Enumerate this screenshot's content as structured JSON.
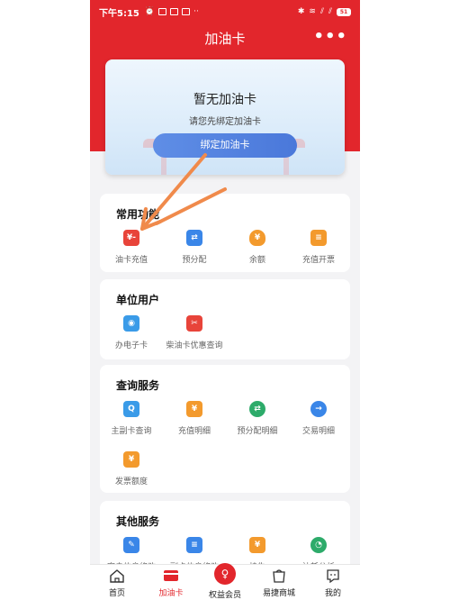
{
  "status_bar": {
    "time": "下午5:15",
    "battery": "51",
    "notification_icons": [
      "alarm-icon",
      "app-icon",
      "app-icon",
      "message-icon",
      "dots-icon"
    ],
    "system_icons": [
      "bluetooth-icon",
      "wifi-signal-icon",
      "signal-icon",
      "signal-icon",
      "battery-icon"
    ]
  },
  "header": {
    "title": "加油卡",
    "more_label": "•••"
  },
  "card": {
    "title": "暂无加油卡",
    "subtitle": "请您先绑定加油卡",
    "bind_button": "绑定加油卡"
  },
  "sections": [
    {
      "title": "常用功能",
      "items": [
        {
          "label": "油卡充值",
          "icon": "yuan-card-icon",
          "glyph": "¥-",
          "color": "#e8443a"
        },
        {
          "label": "预分配",
          "icon": "allocate-icon",
          "glyph": "⇄",
          "color": "#3a86e8"
        },
        {
          "label": "余额",
          "icon": "money-bag-icon",
          "glyph": "¥",
          "color": "#f39a2d"
        },
        {
          "label": "充值开票",
          "icon": "invoice-icon",
          "glyph": "≡",
          "color": "#f39a2d"
        }
      ]
    },
    {
      "title": "单位用户",
      "items": [
        {
          "label": "办电子卡",
          "icon": "nfc-card-icon",
          "glyph": "◉",
          "color": "#3a9be8"
        },
        {
          "label": "柴油卡优惠查询",
          "icon": "ticket-icon",
          "glyph": "✂",
          "color": "#e8443a"
        }
      ]
    },
    {
      "title": "查询服务",
      "items": [
        {
          "label": "主副卡查询",
          "icon": "search-card-icon",
          "glyph": "Q",
          "color": "#3a9be8"
        },
        {
          "label": "充值明细",
          "icon": "clipboard-icon",
          "glyph": "¥",
          "color": "#f39a2d"
        },
        {
          "label": "预分配明细",
          "icon": "transfer-detail-icon",
          "glyph": "⇄",
          "color": "#2dab6a"
        },
        {
          "label": "交易明细",
          "icon": "transaction-icon",
          "glyph": "→",
          "color": "#3a86e8"
        },
        {
          "label": "发票额度",
          "icon": "receipt-icon",
          "glyph": "¥",
          "color": "#f39a2d"
        }
      ]
    },
    {
      "title": "其他服务",
      "items": [
        {
          "label": "客户信息修改",
          "icon": "user-edit-icon",
          "glyph": "✎",
          "color": "#3a86e8"
        },
        {
          "label": "副卡信息修改",
          "icon": "card-edit-icon",
          "glyph": "≡",
          "color": "#3a86e8"
        },
        {
          "label": "挂失",
          "icon": "report-loss-icon",
          "glyph": "¥",
          "color": "#f39a2d"
        },
        {
          "label": "油耗分析",
          "icon": "pie-chart-icon",
          "glyph": "◔",
          "color": "#2dab6a"
        }
      ]
    }
  ],
  "tabbar": [
    {
      "label": "首页",
      "icon": "home-icon"
    },
    {
      "label": "加油卡",
      "icon": "card-icon",
      "active": true
    },
    {
      "label": "权益会员",
      "icon": "member-icon"
    },
    {
      "label": "易捷商城",
      "icon": "mall-icon"
    },
    {
      "label": "我的",
      "icon": "profile-icon"
    }
  ],
  "colors": {
    "brand_red": "#e2262c",
    "button_blue": "#4a78da",
    "annotation_arrow": "#f08a4b"
  }
}
